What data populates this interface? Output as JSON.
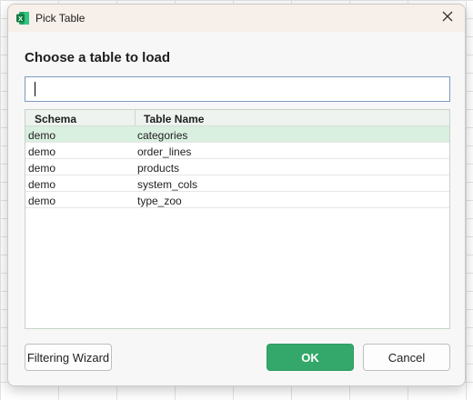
{
  "window": {
    "title": "Pick Table",
    "app_icon": "excel-icon",
    "close_icon": "close-icon"
  },
  "heading": "Choose a table to load",
  "search": {
    "value": "",
    "placeholder": ""
  },
  "table": {
    "columns": [
      "Schema",
      "Table Name"
    ],
    "rows": [
      {
        "schema": "demo",
        "name": "categories",
        "selected": true
      },
      {
        "schema": "demo",
        "name": "order_lines",
        "selected": false
      },
      {
        "schema": "demo",
        "name": "products",
        "selected": false
      },
      {
        "schema": "demo",
        "name": "system_cols",
        "selected": false
      },
      {
        "schema": "demo",
        "name": "type_zoo",
        "selected": false
      }
    ]
  },
  "buttons": {
    "filter": "Filtering Wizard",
    "ok": "OK",
    "cancel": "Cancel"
  },
  "colors": {
    "accent": "#33a86a",
    "selected_row": "#d9efe0",
    "titlebar": "#f7efe9"
  }
}
